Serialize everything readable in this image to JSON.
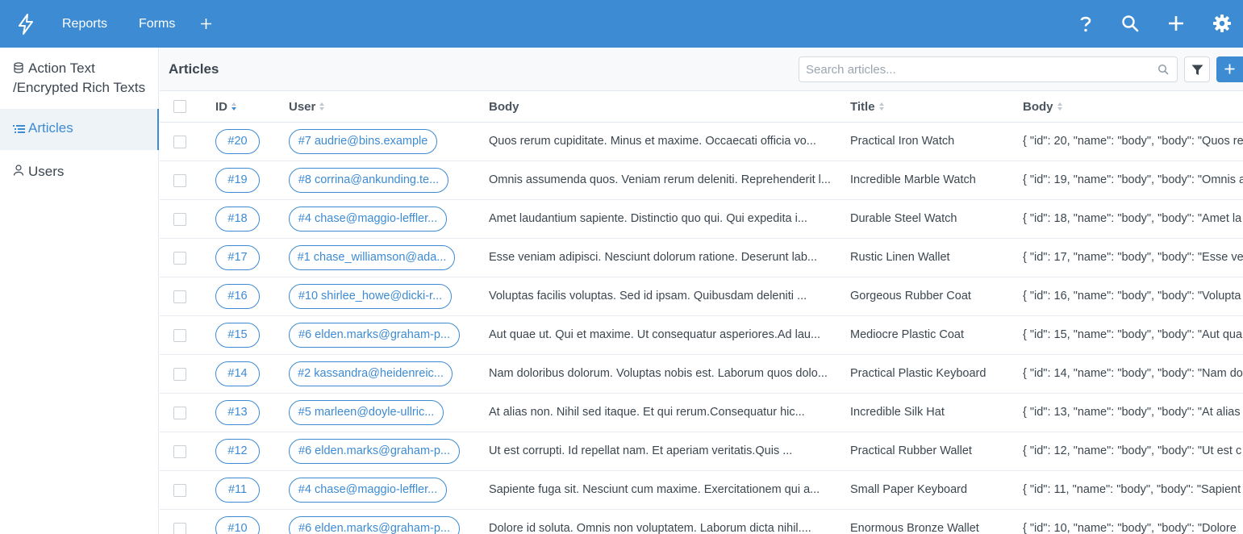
{
  "topbar": {
    "nav": [
      "Reports",
      "Forms"
    ],
    "icons": [
      "bolt-icon",
      "plus-icon",
      "help-icon",
      "search-icon",
      "add-icon",
      "gear-icon"
    ]
  },
  "sidebar": {
    "items": [
      {
        "label": "Action Text\n/Encrypted Rich Texts",
        "icon": "database-icon"
      },
      {
        "label": "Articles",
        "icon": "list-icon",
        "active": true
      },
      {
        "label": "Users",
        "icon": "user-icon"
      }
    ]
  },
  "main": {
    "title": "Articles",
    "search_placeholder": "Search articles...",
    "columns": [
      "ID",
      "User",
      "Body",
      "Title",
      "Body"
    ],
    "rows": [
      {
        "id": "#20",
        "user": "#7 audrie@bins.example",
        "body": "Quos rerum cupiditate. Minus et maxime. Occaecati officia vo...",
        "title": "Practical Iron Watch",
        "json": "{ \"id\": 20, \"name\": \"body\", \"body\": \"Quos re"
      },
      {
        "id": "#19",
        "user": "#8 corrina@ankunding.te...",
        "body": "Omnis assumenda quos. Veniam rerum deleniti. Reprehenderit l...",
        "title": "Incredible Marble Watch",
        "json": "{ \"id\": 19, \"name\": \"body\", \"body\": \"Omnis a"
      },
      {
        "id": "#18",
        "user": "#4 chase@maggio-leffler...",
        "body": "Amet laudantium sapiente. Distinctio quo qui. Qui expedita i...",
        "title": "Durable Steel Watch",
        "json": "{ \"id\": 18, \"name\": \"body\", \"body\": \"Amet la"
      },
      {
        "id": "#17",
        "user": "#1 chase_williamson@ada...",
        "body": "Esse veniam adipisci. Nesciunt dolorum ratione. Deserunt lab...",
        "title": "Rustic Linen Wallet",
        "json": "{ \"id\": 17, \"name\": \"body\", \"body\": \"Esse ve"
      },
      {
        "id": "#16",
        "user": "#10 shirlee_howe@dicki-r...",
        "body": "Voluptas facilis voluptas. Sed id ipsam. Quibusdam deleniti ...",
        "title": "Gorgeous Rubber Coat",
        "json": "{ \"id\": 16, \"name\": \"body\", \"body\": \"Volupta"
      },
      {
        "id": "#15",
        "user": "#6 elden.marks@graham-p...",
        "body": "Aut quae ut. Qui et maxime. Ut consequatur asperiores.Ad lau...",
        "title": "Mediocre Plastic Coat",
        "json": "{ \"id\": 15, \"name\": \"body\", \"body\": \"Aut qua"
      },
      {
        "id": "#14",
        "user": "#2 kassandra@heidenreic...",
        "body": "Nam doloribus dolorum. Voluptas nobis est. Laborum quos dolo...",
        "title": "Practical Plastic Keyboard",
        "json": "{ \"id\": 14, \"name\": \"body\", \"body\": \"Nam do"
      },
      {
        "id": "#13",
        "user": "#5 marleen@doyle-ullric...",
        "body": "At alias non. Nihil sed itaque. Et qui rerum.Consequatur hic...",
        "title": "Incredible Silk Hat",
        "json": "{ \"id\": 13, \"name\": \"body\", \"body\": \"At alias"
      },
      {
        "id": "#12",
        "user": "#6 elden.marks@graham-p...",
        "body": "Ut est corrupti. Id repellat nam. Et aperiam veritatis.Quis ...",
        "title": "Practical Rubber Wallet",
        "json": "{ \"id\": 12, \"name\": \"body\", \"body\": \"Ut est c"
      },
      {
        "id": "#11",
        "user": "#4 chase@maggio-leffler...",
        "body": "Sapiente fuga sit. Nesciunt cum maxime. Exercitationem qui a...",
        "title": "Small Paper Keyboard",
        "json": "{ \"id\": 11, \"name\": \"body\", \"body\": \"Sapient"
      },
      {
        "id": "#10",
        "user": "#6 elden.marks@graham-p...",
        "body": "Dolore id soluta. Omnis non voluptatem. Laborum dicta nihil....",
        "title": "Enormous Bronze Wallet",
        "json": "{ \"id\": 10, \"name\": \"body\", \"body\": \"Dolore"
      }
    ]
  },
  "colors": {
    "accent": "#3d8bd3",
    "text": "#3c4650"
  }
}
